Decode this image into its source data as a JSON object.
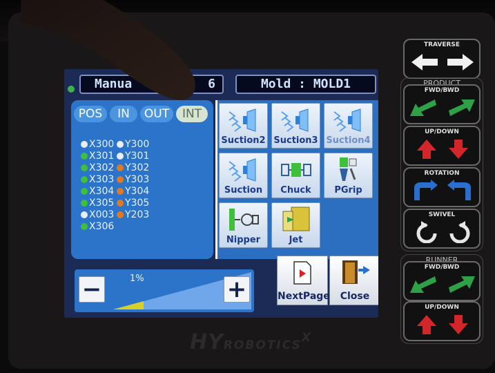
{
  "header": {
    "mode_title": "Manua",
    "mode_number": "6",
    "mold_label": "Mold : MOLD1"
  },
  "tabs": [
    {
      "label": "POS",
      "active": false
    },
    {
      "label": "IN",
      "active": false
    },
    {
      "label": "OUT",
      "active": false
    },
    {
      "label": "INT",
      "active": true
    }
  ],
  "io_rows": [
    {
      "x": "X300",
      "x_state": "white",
      "y": "Y300",
      "y_state": "white"
    },
    {
      "x": "X301",
      "x_state": "green",
      "y": "Y301",
      "y_state": "white"
    },
    {
      "x": "X302",
      "x_state": "green",
      "y": "Y302",
      "y_state": "orange"
    },
    {
      "x": "X303",
      "x_state": "green",
      "y": "Y303",
      "y_state": "orange"
    },
    {
      "x": "X304",
      "x_state": "green",
      "y": "Y304",
      "y_state": "orange"
    },
    {
      "x": "X305",
      "x_state": "green",
      "y": "Y305",
      "y_state": "orange"
    },
    {
      "x": "X003",
      "x_state": "white",
      "y": "Y203",
      "y_state": "orange"
    },
    {
      "x": "X306",
      "x_state": "green",
      "y": "",
      "y_state": ""
    }
  ],
  "functions": [
    {
      "label": "Suction2",
      "icon": "suction-icon"
    },
    {
      "label": "Suction3",
      "icon": "suction-icon"
    },
    {
      "label": "Suction4",
      "icon": "suction-icon"
    },
    {
      "label": "Suction",
      "icon": "suction-icon"
    },
    {
      "label": "Chuck",
      "icon": "chuck-icon"
    },
    {
      "label": "PGrip",
      "icon": "pgrip-icon"
    },
    {
      "label": "Nipper",
      "icon": "nipper-icon"
    },
    {
      "label": "Jet",
      "icon": "jet-icon"
    }
  ],
  "speed": {
    "value": "1%",
    "minus": "−",
    "plus": "+"
  },
  "nav": {
    "next_page": "NextPage",
    "close": "Close"
  },
  "hardware": {
    "traverse": "TRAVERSE",
    "product_group": "PRODUCT",
    "fwd_bwd": "FWD/BWD",
    "up_down": "UP/DOWN",
    "rotation": "ROTATION",
    "swivel": "SWIVEL",
    "runner_group": "RUNNER",
    "runner_fwd_bwd": "FWD/BWD",
    "runner_up_down": "UP/DOWN"
  },
  "brand": {
    "main": "HY",
    "sub": "ROBOTICS",
    "mark": "X"
  },
  "colors": {
    "screen_bg": "#1c2b55",
    "panel": "#2b74c9",
    "led_green": "#3fc03a",
    "led_orange": "#e07a22",
    "arrow_green": "#2fa047",
    "arrow_red": "#d3262a",
    "arrow_blue": "#2a6fd0"
  }
}
